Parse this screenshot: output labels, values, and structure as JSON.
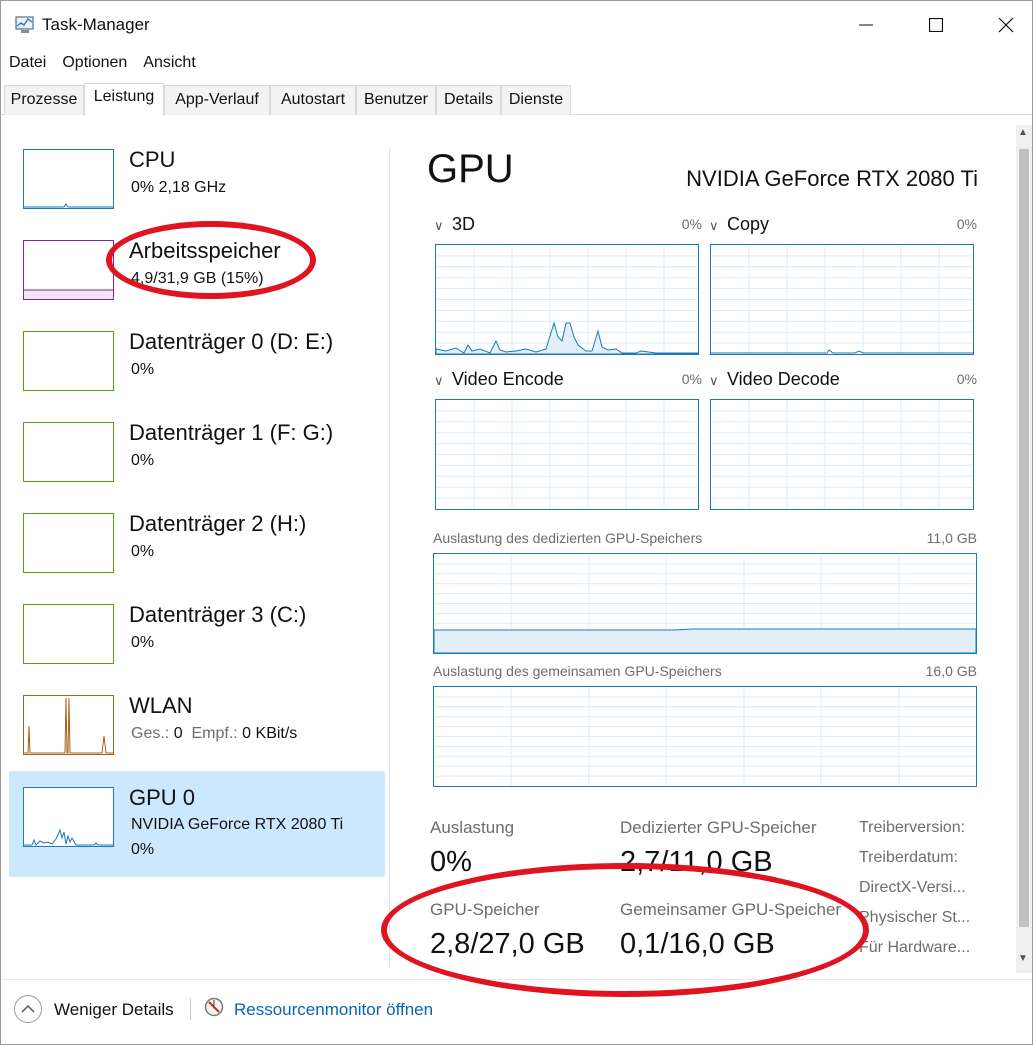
{
  "window": {
    "title": "Task-Manager"
  },
  "menu": [
    "Datei",
    "Optionen",
    "Ansicht"
  ],
  "tabs": [
    "Prozesse",
    "Leistung",
    "App-Verlauf",
    "Autostart",
    "Benutzer",
    "Details",
    "Dienste"
  ],
  "active_tab": "Leistung",
  "resources": [
    {
      "name": "CPU",
      "sub": "0%  2,18 GHz",
      "color": "#1a7ab8"
    },
    {
      "name": "Arbeitsspeicher",
      "sub": "4,9/31,9 GB (15%)",
      "color": "#8b1ea8"
    },
    {
      "name": "Datenträger 0 (D: E:)",
      "sub": "0%",
      "color": "#4da60c"
    },
    {
      "name": "Datenträger 1 (F: G:)",
      "sub": "0%",
      "color": "#4da60c"
    },
    {
      "name": "Datenträger 2 (H:)",
      "sub": "0%",
      "color": "#4da60c"
    },
    {
      "name": "Datenträger 3 (C:)",
      "sub": "0%",
      "color": "#4da60c"
    },
    {
      "name": "WLAN",
      "sent_label": "Ges.:",
      "sent_value": "0",
      "recv_label": "Empf.:",
      "recv_value": "0 KBit/s",
      "color": "#a7611a"
    },
    {
      "name": "GPU 0",
      "sub": "NVIDIA GeForce RTX 2080 Ti",
      "sub2": "0%",
      "color": "#1a7ab8"
    }
  ],
  "gpu": {
    "title": "GPU",
    "model": "NVIDIA GeForce RTX 2080 Ti",
    "engines": [
      {
        "label": "3D",
        "pct": "0%"
      },
      {
        "label": "Copy",
        "pct": "0%"
      },
      {
        "label": "Video Encode",
        "pct": "0%"
      },
      {
        "label": "Video Decode",
        "pct": "0%"
      }
    ],
    "dedicated_mem": {
      "label": "Auslastung des dedizierten GPU-Speichers",
      "max": "11,0 GB"
    },
    "shared_mem": {
      "label": "Auslastung des gemeinsamen GPU-Speichers",
      "max": "16,0 GB"
    },
    "stats": {
      "utilization": {
        "label": "Auslastung",
        "value": "0%"
      },
      "dedicated": {
        "label": "Dedizierter GPU-Speicher",
        "value": "2,7/11,0 GB"
      },
      "gpu_memory": {
        "label": "GPU-Speicher",
        "value": "2,8/27,0 GB"
      },
      "shared": {
        "label": "Gemeinsamer GPU-Speicher",
        "value": "0,1/16,0 GB"
      }
    },
    "info_labels": [
      "Treiberversion:",
      "Treiberdatum:",
      "DirectX-Versi...",
      "Physischer St...",
      "Für Hardware..."
    ]
  },
  "footer": {
    "fewer_details": "Weniger Details",
    "resource_monitor": "Ressourcenmonitor öffnen"
  },
  "annotations": {
    "color": "#e01320"
  },
  "colors": {
    "selection": "#cce8ff",
    "graph_border": "#1a7ab8",
    "link": "#0b63b1"
  }
}
